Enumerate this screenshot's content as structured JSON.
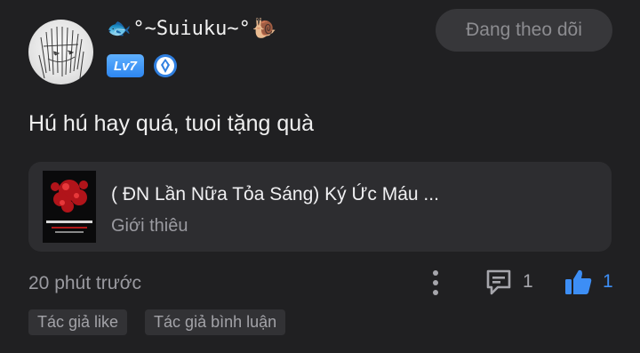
{
  "comment": {
    "username": "°~Suiuku~°",
    "username_prefix_icon": "fish-emoji",
    "username_suffix_icon": "snail-emoji",
    "level": "Lv7",
    "verified_icon": "verified-badge-icon",
    "follow_label": "Đang theo dõi",
    "text": "Hú hú hay quá, tuoi tặng quà",
    "time": "20 phút trước",
    "reply_count": "1",
    "like_count": "1"
  },
  "book": {
    "title": "( ĐN Lần Nữa Tỏa Sáng) Ký Ức Máu ...",
    "subtitle": "Giới thiêu"
  },
  "tags": [
    "Tác giả like",
    "Tác giả bình luận"
  ],
  "colors": {
    "background": "#202022",
    "card": "#2d2d30",
    "accent_blue": "#3d8ef5",
    "level_badge": "#2d86f0"
  }
}
